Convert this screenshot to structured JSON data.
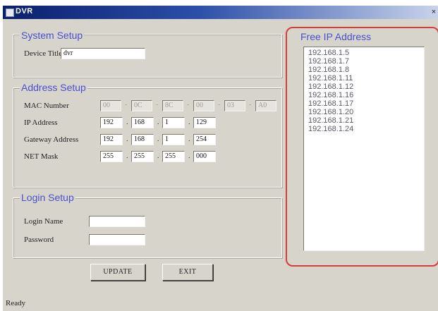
{
  "window": {
    "title": "DVR",
    "close": "×"
  },
  "system_setup": {
    "title": "System Setup",
    "device_title_label": "Device Title",
    "device_title_value": "dvr"
  },
  "address_setup": {
    "title": "Address Setup",
    "mac_label": "MAC Number",
    "mac": [
      "00",
      "0C",
      "8C",
      "00",
      "03",
      "A0"
    ],
    "ip_label": "IP Address",
    "ip": [
      "192",
      "168",
      "1",
      "129"
    ],
    "gateway_label": "Gateway Address",
    "gateway": [
      "192",
      "168",
      "1",
      "254"
    ],
    "netmask_label": "NET Mask",
    "netmask": [
      "255",
      "255",
      "255",
      "000"
    ]
  },
  "login_setup": {
    "title": "Login Setup",
    "login_name_label": "Login Name",
    "login_name_value": "",
    "password_label": "Password",
    "password_value": ""
  },
  "buttons": {
    "update": "UPDATE",
    "exit": "EXIT"
  },
  "free_ip": {
    "title": "Free IP Address",
    "items": [
      "192.168.1.5",
      "192.168.1.7",
      "192.168.1.8",
      "192.168.1.11",
      "192.168.1.12",
      "192.168.1.16",
      "192.168.1.17",
      "192.168.1.20",
      "192.168.1.21",
      "192.168.1.24"
    ]
  },
  "status": {
    "text": "Ready"
  },
  "colors": {
    "title_bar": "#0a1f6e",
    "group_title": "#4a4fd1",
    "highlight": "#d63c3c",
    "window_bg": "#d7d4cc"
  }
}
